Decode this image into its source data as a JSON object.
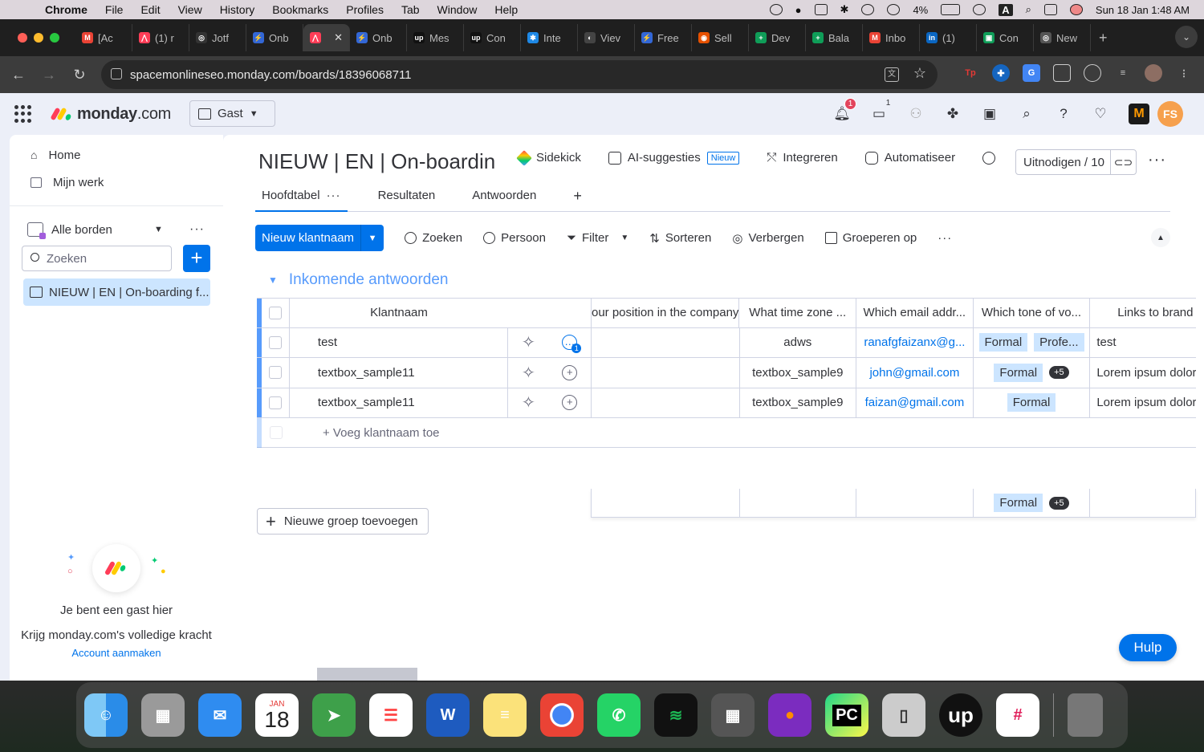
{
  "menubar": {
    "app": "Chrome",
    "items": [
      "File",
      "Edit",
      "View",
      "History",
      "Bookmarks",
      "Profiles",
      "Tab",
      "Window",
      "Help"
    ],
    "battery": "4%",
    "input": "A",
    "datetime": "Sun 18 Jan  1:48 AM"
  },
  "tabs": [
    {
      "label": "[Ac",
      "fav": "M",
      "color": "#ea4335"
    },
    {
      "label": "(1) r",
      "fav": "⋀",
      "color": "#ff3d57"
    },
    {
      "label": "Jotf",
      "fav": "◎",
      "color": "#333333"
    },
    {
      "label": "Onb",
      "fav": "⚡",
      "color": "#3367d6"
    },
    {
      "label": "",
      "fav": "⋀",
      "color": "#ff3d57",
      "active": true
    },
    {
      "label": "Onb",
      "fav": "⚡",
      "color": "#3367d6"
    },
    {
      "label": "Mes",
      "fav": "up",
      "color": "#111111"
    },
    {
      "label": "Con",
      "fav": "up",
      "color": "#111111"
    },
    {
      "label": "Inte",
      "fav": "✱",
      "color": "#1e88e5"
    },
    {
      "label": "Viev",
      "fav": "◐",
      "color": "#444444"
    },
    {
      "label": "Free",
      "fav": "⚡",
      "color": "#3367d6"
    },
    {
      "label": "Sell",
      "fav": "◉",
      "color": "#e65100"
    },
    {
      "label": "Dev",
      "fav": "+",
      "color": "#0f9d58"
    },
    {
      "label": "Bala",
      "fav": "+",
      "color": "#0f9d58"
    },
    {
      "label": "Inbo",
      "fav": "M",
      "color": "#ea4335"
    },
    {
      "label": "(1) ",
      "fav": "in",
      "color": "#0a66c2"
    },
    {
      "label": "Con",
      "fav": "▣",
      "color": "#0f9d58"
    },
    {
      "label": "New",
      "fav": "◎",
      "color": "#555555"
    }
  ],
  "address": {
    "url": "spacemonlineseo.monday.com/boards/18396068711"
  },
  "topnav": {
    "brand": "monday",
    "brand_suffix": ".com",
    "workspace": "Gast",
    "notif_count": "1",
    "inbox_count": "1",
    "avatar_initials": "FS"
  },
  "sidebar": {
    "home": "Home",
    "my_work": "Mijn werk",
    "all_boards": "Alle borden",
    "search_placeholder": "Zoeken",
    "board_name": "NIEUW | EN | On-boarding f...",
    "promo_title": "Je bent een gast hier",
    "promo_text": "Krijg monday.com's volledige kracht",
    "promo_link": "Account aanmaken"
  },
  "board": {
    "title": "NIEUW | EN | On-boardin",
    "sidekick": "Sidekick",
    "ai": "AI-suggesties",
    "ai_badge": "Nieuw",
    "integrate": "Integreren",
    "automate": "Automatiseer",
    "invite": "Uitnodigen / 10",
    "tabs": [
      "Hoofdtabel",
      "Resultaten",
      "Antwoorden"
    ],
    "new_item": "Nieuw klantnaam",
    "tools": [
      "Zoeken",
      "Persoon",
      "Filter",
      "Sorteren",
      "Verbergen",
      "Groeperen op"
    ],
    "group_title": "Inkomende antwoorden",
    "columns": {
      "name": "Klantnaam",
      "position": "What's your position in the company?",
      "tz": "What time zone ...",
      "email": "Which email addr...",
      "tone": "Which tone of vo...",
      "links": "Links to brand"
    },
    "rows": [
      {
        "name": "test",
        "position": "",
        "tz": "adws",
        "email": "ranafgfaizanx@g...",
        "tone": [
          "Formal",
          "Profe..."
        ],
        "tone_more": "",
        "links": "test"
      },
      {
        "name": "textbox_sample11",
        "position": "",
        "tz": "textbox_sample9",
        "email": "john@gmail.com",
        "tone": [
          "Formal"
        ],
        "tone_more": "+5",
        "links": "Lorem ipsum dolor"
      },
      {
        "name": "textbox_sample11",
        "position": "",
        "tz": "textbox_sample9",
        "email": "faizan@gmail.com",
        "tone": [
          "Formal"
        ],
        "tone_more": "",
        "links": "Lorem ipsum dolor"
      }
    ],
    "add_row": "+ Voeg klantnaam toe",
    "summary_tone": "Formal",
    "summary_more": "+5",
    "add_group": "Nieuwe groep toevoegen",
    "help": "Hulp"
  },
  "dock": {
    "calendar_month": "JAN",
    "calendar_day": "18"
  }
}
